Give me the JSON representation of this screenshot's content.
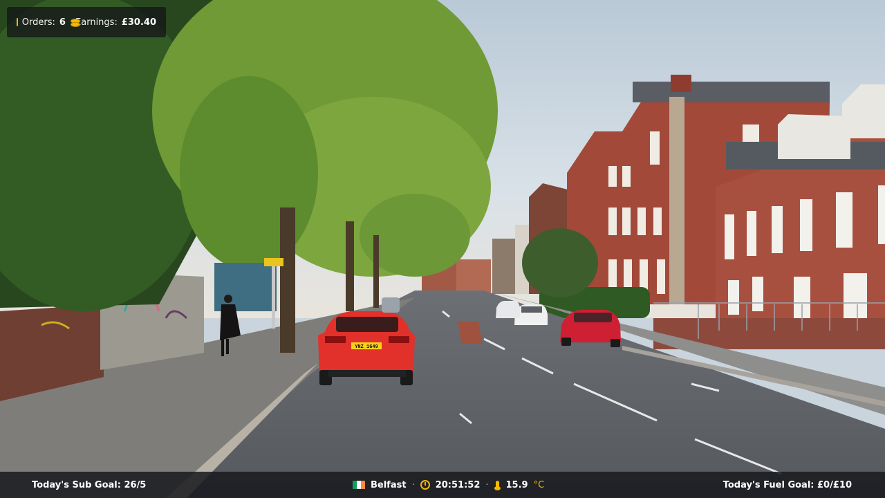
{
  "hud_top": {
    "orders_label": "Orders:",
    "orders_value": "6",
    "earnings_label": "Earnings:",
    "earnings_value": "£30.40"
  },
  "hud_bottom": {
    "sub_goal": "Today's Sub Goal: 26/5",
    "city": "Belfast",
    "time": "20:51:52",
    "temperature": "15.9",
    "temperature_unit": "°C",
    "fuel_goal": "Today's Fuel Goal: £0/£10",
    "separator": "·"
  },
  "scene": {
    "number_plate": "YNZ 1649"
  },
  "colors": {
    "accent": "#f5b800",
    "flag_green": "#169b62",
    "flag_white": "#ffffff",
    "flag_orange": "#ff883e"
  }
}
